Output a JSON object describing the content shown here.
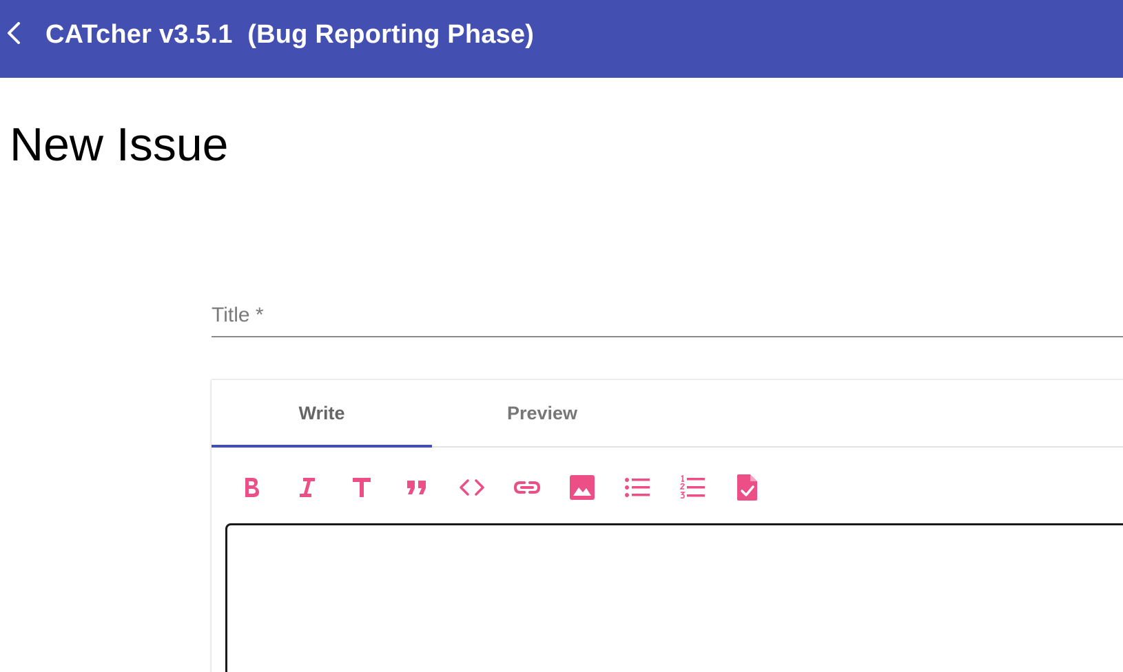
{
  "topbar": {
    "title": "CATcher v3.5.1  (Bug Reporting Phase)",
    "color": "#4450b1",
    "back_icon": "chevron-left-icon"
  },
  "page": {
    "heading": "New Issue"
  },
  "form": {
    "title_placeholder": "Title *",
    "title_value": ""
  },
  "editor": {
    "tabs": [
      {
        "label": "Write",
        "active": true
      },
      {
        "label": "Preview",
        "active": false
      }
    ],
    "toolbar_color": "#ec4e86",
    "toolbar": [
      {
        "icon": "bold-icon"
      },
      {
        "icon": "italic-icon"
      },
      {
        "icon": "heading-icon"
      },
      {
        "icon": "quote-icon"
      },
      {
        "icon": "code-icon"
      },
      {
        "icon": "link-icon"
      },
      {
        "icon": "image-icon"
      },
      {
        "icon": "bulleted-list-icon"
      },
      {
        "icon": "numbered-list-icon"
      },
      {
        "icon": "task-list-icon"
      }
    ],
    "body_value": ""
  }
}
